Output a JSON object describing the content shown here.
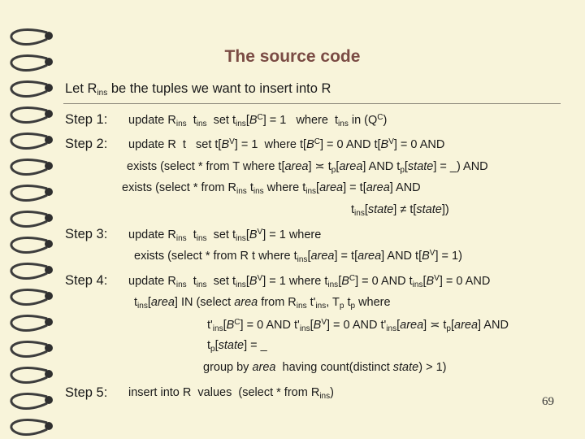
{
  "title": "The source code",
  "intro": {
    "a": "Let R",
    "sub": "ins",
    "b": " be the tuples we want to insert into R"
  },
  "steps": {
    "s1": "Step 1:",
    "s2": "Step 2:",
    "s3": "Step 3:",
    "s4": "Step 4:",
    "s5": "Step 5:"
  },
  "page_number": "69"
}
